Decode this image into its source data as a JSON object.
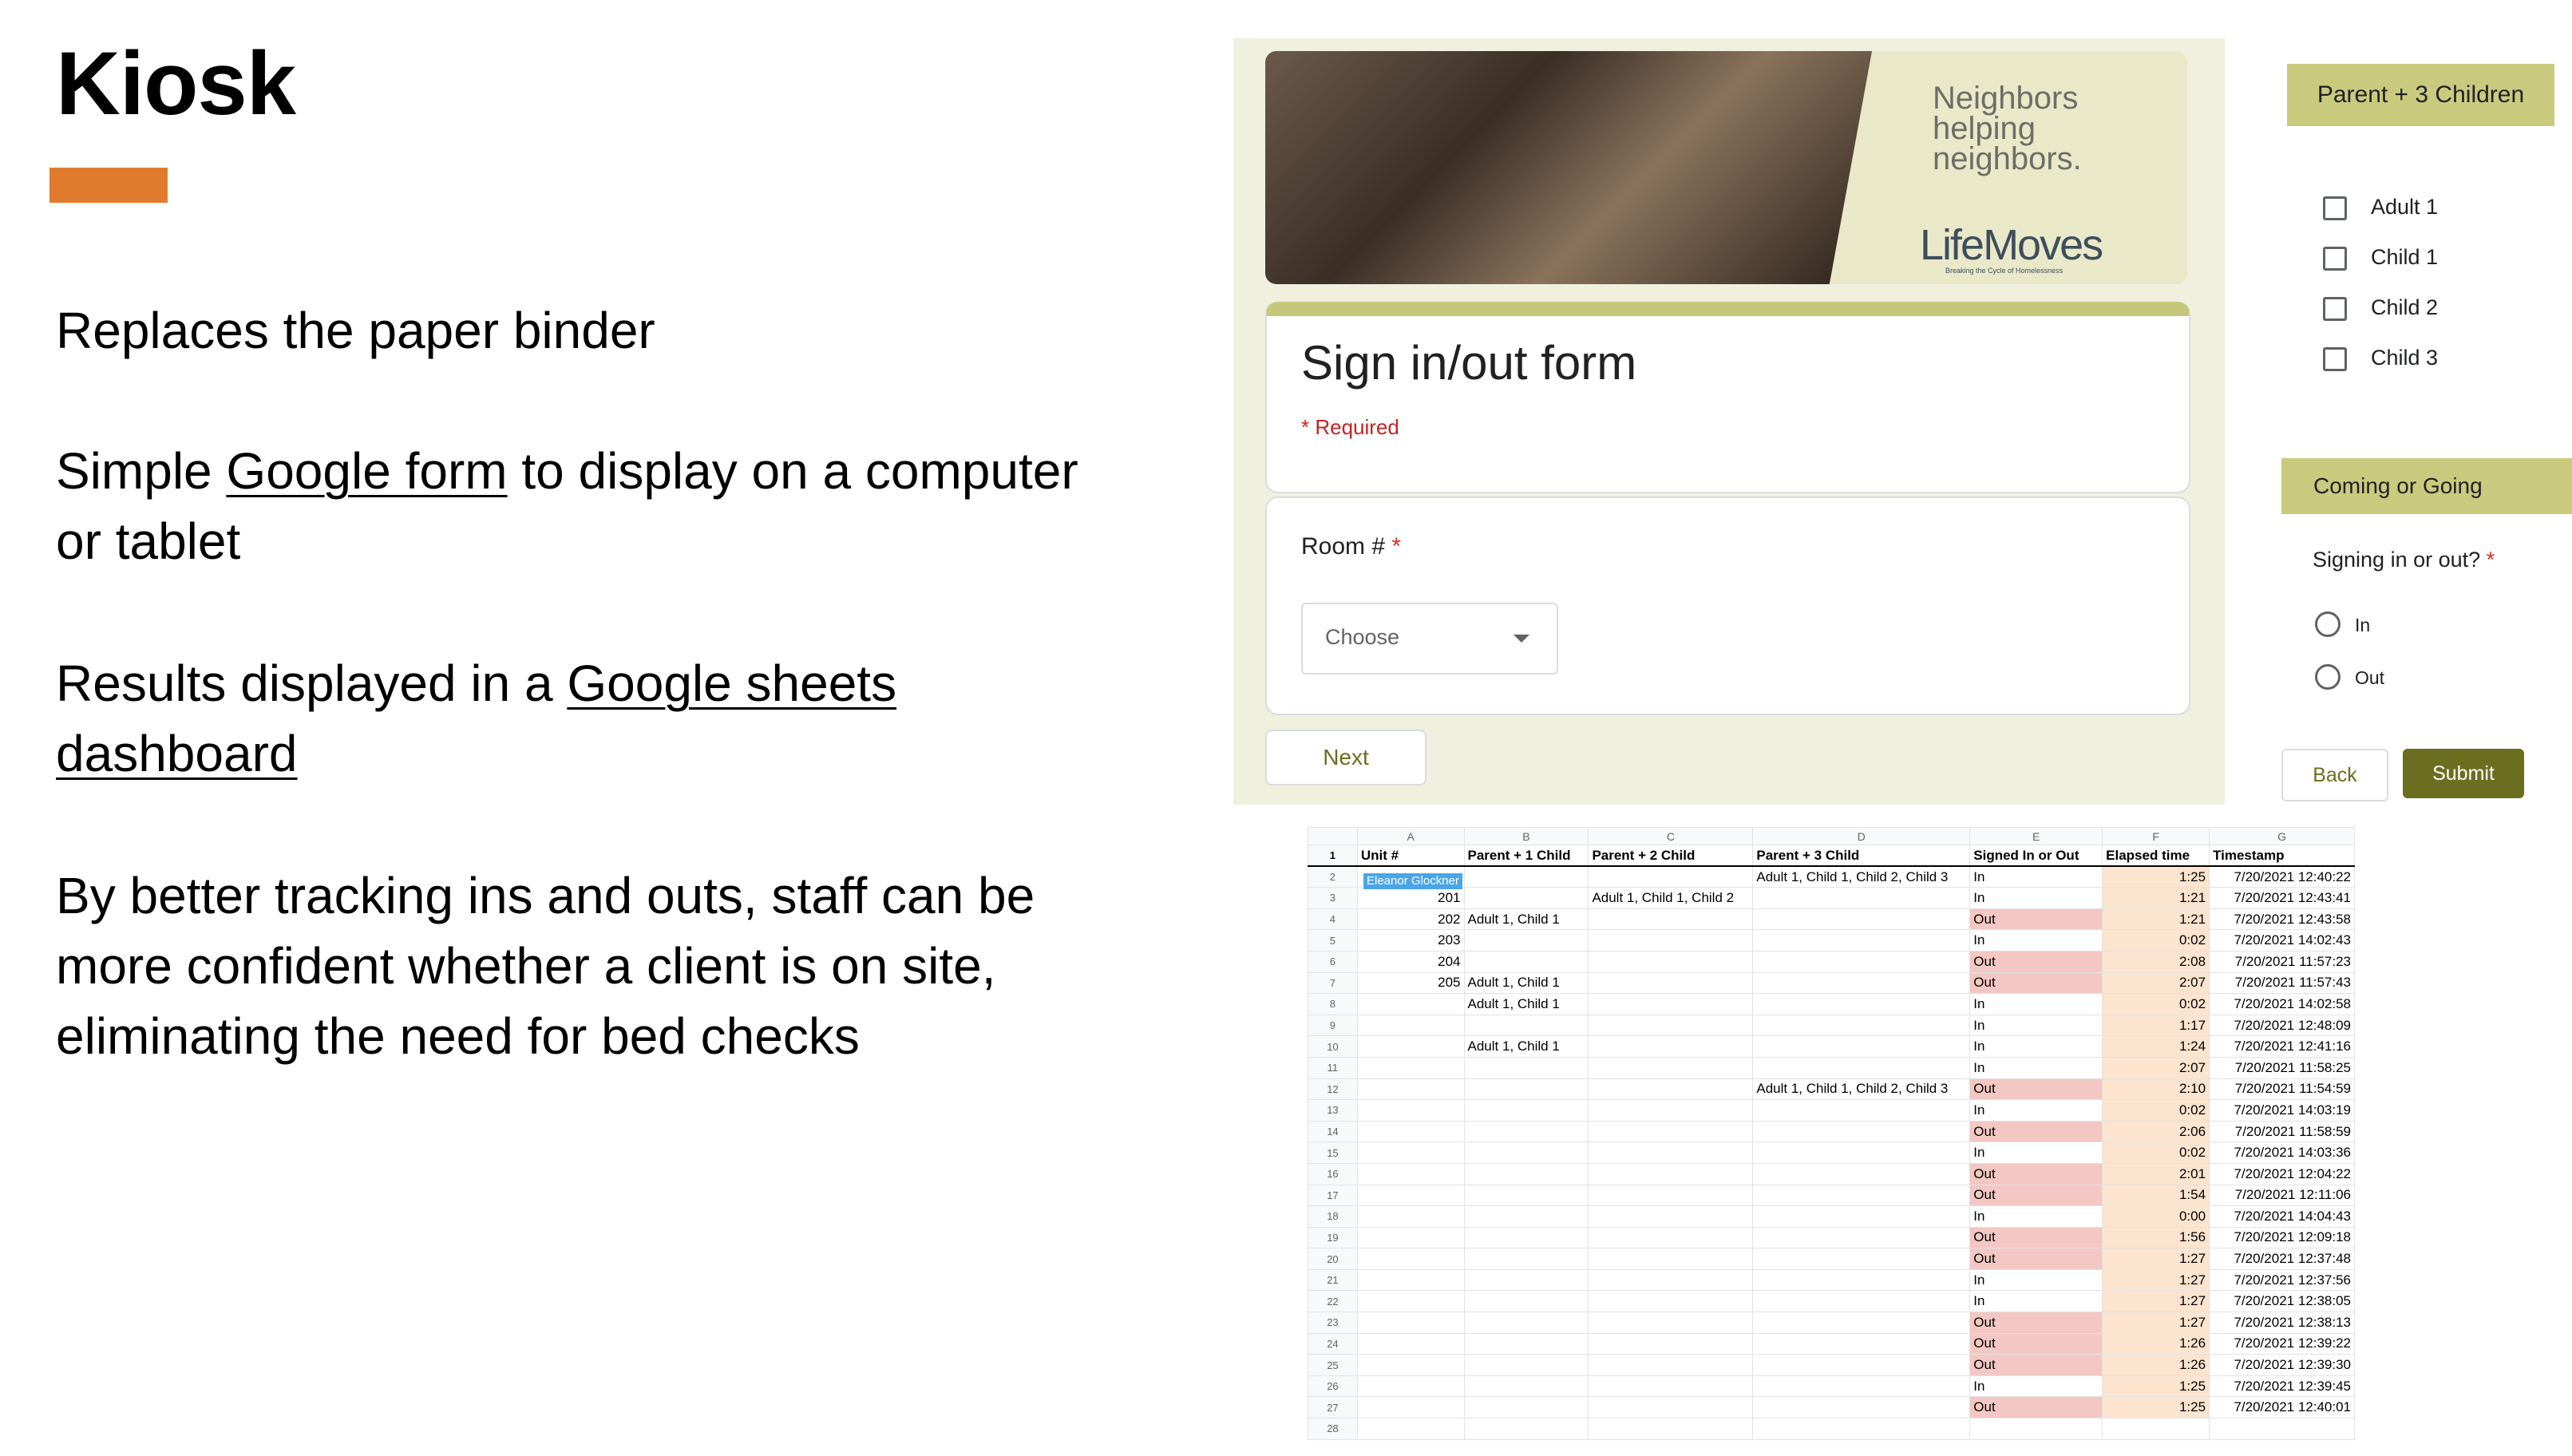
{
  "slide": {
    "title": "Kiosk",
    "accent_color": "#E07B2E",
    "para1": "Replaces the paper binder",
    "para2_a": "Simple ",
    "para2_link": "Google form",
    "para2_b": " to display on a computer or tablet",
    "para3_a": "Results displayed in a ",
    "para3_link": "Google sheets dashboard",
    "para4": "By better tracking ins and outs, staff can be more confident whether a client is on site, eliminating the need for bed checks"
  },
  "form": {
    "banner_tagline": "Neighbors helping neighbors.",
    "banner_logo": "LifeMoves",
    "banner_logo_sub": "Breaking the Cycle of Homelessness",
    "title": "Sign in/out form",
    "required_note": "* Required",
    "room_label": "Room #",
    "required_star": "*",
    "room_select_value": "Choose",
    "next_label": "Next",
    "section1_title": "Parent + 3 Children",
    "checkboxes": [
      "Adult 1",
      "Child 1",
      "Child 2",
      "Child 3"
    ],
    "section2_title": "Coming or Going",
    "question": "Signing in or out?",
    "radios": [
      "In",
      "Out"
    ],
    "back_label": "Back",
    "submit_label": "Submit"
  },
  "sheet": {
    "col_letters": [
      "A",
      "B",
      "C",
      "D",
      "E",
      "F",
      "G"
    ],
    "headers": [
      "Unit #",
      "Parent + 1 Child",
      "Parent + 2 Child",
      "Parent + 3 Child",
      "Signed In or Out",
      "Elapsed time",
      "Timestamp"
    ],
    "editor_tag": "Eleanor Glockner",
    "rows": [
      [
        "2",
        "",
        "",
        "Adult 1, Child 1, Child 2, Child 3",
        "In",
        "1:25",
        "7/20/2021 12:40:22"
      ],
      [
        "3",
        "201",
        "",
        "Adult 1, Child 1, Child 2",
        "",
        "In",
        "1:21",
        "7/20/2021 12:43:41"
      ],
      [
        "4",
        "202",
        "Adult 1, Child 1",
        "",
        "",
        "Out",
        "1:21",
        "7/20/2021 12:43:58"
      ],
      [
        "5",
        "203",
        "",
        "",
        "",
        "In",
        "0:02",
        "7/20/2021 14:02:43"
      ],
      [
        "6",
        "204",
        "",
        "",
        "",
        "Out",
        "2:08",
        "7/20/2021 11:57:23"
      ],
      [
        "7",
        "205",
        "Adult 1, Child 1",
        "",
        "",
        "Out",
        "2:07",
        "7/20/2021 11:57:43"
      ],
      [
        "8",
        "",
        "Adult 1, Child 1",
        "",
        "",
        "In",
        "0:02",
        "7/20/2021 14:02:58"
      ],
      [
        "9",
        "",
        "",
        "",
        "",
        "In",
        "1:17",
        "7/20/2021 12:48:09"
      ],
      [
        "10",
        "",
        "Adult 1, Child 1",
        "",
        "",
        "In",
        "1:24",
        "7/20/2021 12:41:16"
      ],
      [
        "11",
        "",
        "",
        "",
        "",
        "In",
        "2:07",
        "7/20/2021 11:58:25"
      ],
      [
        "12",
        "",
        "",
        "",
        "Adult 1, Child 1, Child 2, Child 3",
        "Out",
        "2:10",
        "7/20/2021 11:54:59"
      ],
      [
        "13",
        "",
        "",
        "",
        "",
        "In",
        "0:02",
        "7/20/2021 14:03:19"
      ],
      [
        "14",
        "",
        "",
        "",
        "",
        "Out",
        "2:06",
        "7/20/2021 11:58:59"
      ],
      [
        "15",
        "",
        "",
        "",
        "",
        "In",
        "0:02",
        "7/20/2021 14:03:36"
      ],
      [
        "16",
        "",
        "",
        "",
        "",
        "Out",
        "2:01",
        "7/20/2021 12:04:22"
      ],
      [
        "17",
        "",
        "",
        "",
        "",
        "Out",
        "1:54",
        "7/20/2021 12:11:06"
      ],
      [
        "18",
        "",
        "",
        "",
        "",
        "In",
        "0:00",
        "7/20/2021 14:04:43"
      ],
      [
        "19",
        "",
        "",
        "",
        "",
        "Out",
        "1:56",
        "7/20/2021 12:09:18"
      ],
      [
        "20",
        "",
        "",
        "",
        "",
        "Out",
        "1:27",
        "7/20/2021 12:37:48"
      ],
      [
        "21",
        "",
        "",
        "",
        "",
        "In",
        "1:27",
        "7/20/2021 12:37:56"
      ],
      [
        "22",
        "",
        "",
        "",
        "",
        "In",
        "1:27",
        "7/20/2021 12:38:05"
      ],
      [
        "23",
        "",
        "",
        "",
        "",
        "Out",
        "1:27",
        "7/20/2021 12:38:13"
      ],
      [
        "24",
        "",
        "",
        "",
        "",
        "Out",
        "1:26",
        "7/20/2021 12:39:22"
      ],
      [
        "25",
        "",
        "",
        "",
        "",
        "Out",
        "1:26",
        "7/20/2021 12:39:30"
      ],
      [
        "26",
        "",
        "",
        "",
        "",
        "In",
        "1:25",
        "7/20/2021 12:39:45"
      ],
      [
        "27",
        "",
        "",
        "",
        "",
        "Out",
        "1:25",
        "7/20/2021 12:40:01"
      ],
      [
        "28",
        "",
        "",
        "",
        "",
        "",
        "",
        ""
      ]
    ]
  }
}
